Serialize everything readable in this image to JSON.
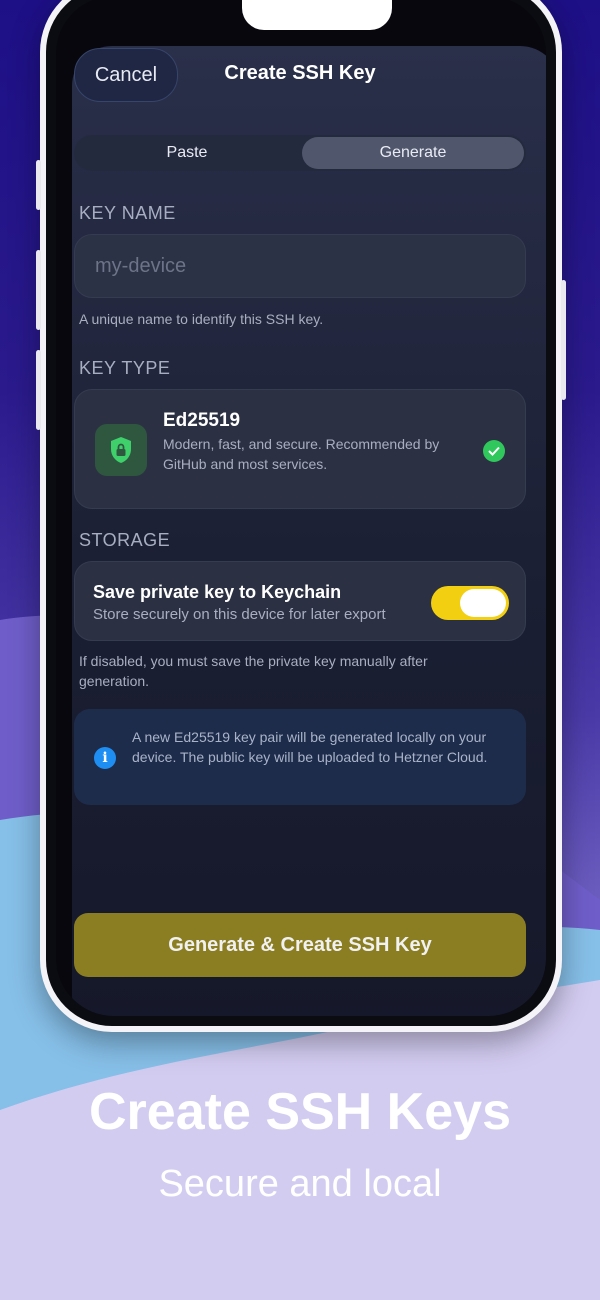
{
  "header": {
    "cancel_label": "Cancel",
    "title": "Create SSH Key"
  },
  "segmented": {
    "items": [
      {
        "label": "Paste"
      },
      {
        "label": "Generate",
        "selected": true
      }
    ]
  },
  "key_name": {
    "section_label": "KEY NAME",
    "placeholder": "my-device",
    "value": "",
    "help": "A unique name to identify this SSH key."
  },
  "key_type": {
    "section_label": "KEY TYPE",
    "name": "Ed25519",
    "description": "Modern, fast, and secure. Recommended by GitHub and most services.",
    "icon": "shield-lock-icon",
    "selected_icon": "checkmark-circle-icon"
  },
  "storage": {
    "section_label": "STORAGE",
    "title": "Save private key to Keychain",
    "subtitle": "Store securely on this device for later export",
    "toggle_on": true,
    "help": "If disabled, you must save the private key manually after generation."
  },
  "info": {
    "icon": "info-icon",
    "text": "A new Ed25519 key pair will be generated locally on your device. The public key will be uploaded to Hetzner Cloud."
  },
  "primary_button": {
    "label": "Generate & Create SSH Key"
  },
  "promo": {
    "title": "Create SSH Keys",
    "subtitle": "Secure and local"
  },
  "colors": {
    "accent_yellow": "#f2cf10",
    "button_olive": "#8b7d22",
    "success_green": "#30c75c",
    "info_blue": "#1e8ef2"
  }
}
